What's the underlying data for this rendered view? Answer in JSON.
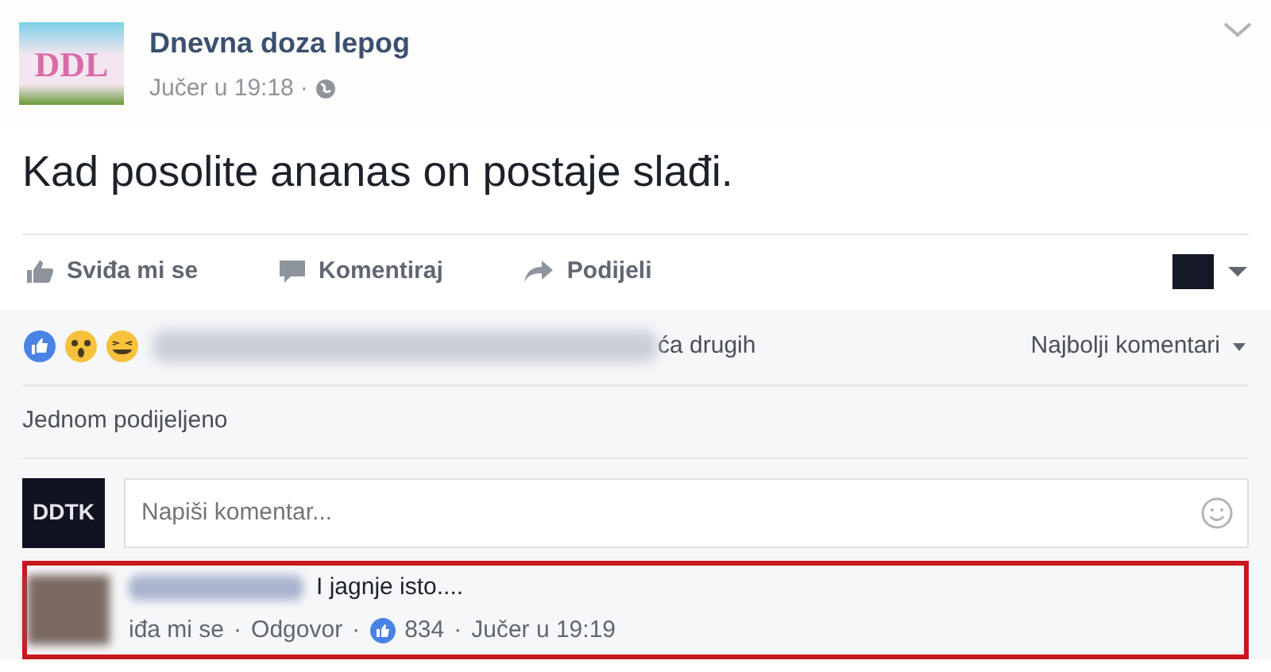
{
  "post": {
    "page_name": "Dnevna doza lepog",
    "logo_text": "DDL",
    "time": "Jučer u 19:18",
    "separator": "·",
    "text": "Kad posolite ananas on postaje slađi."
  },
  "actions": [
    {
      "kind": "like",
      "label": "Sviđa mi se"
    },
    {
      "kind": "comment",
      "label": "Komentiraj"
    },
    {
      "kind": "share",
      "label": "Podijeli"
    }
  ],
  "reactions": {
    "summary_visible": "ća drugih",
    "sort": "Najbolji komentari"
  },
  "shares": "Jednom podijeljeno",
  "comment_box": {
    "avatar_text": "DDTK",
    "placeholder": "Napiši komentar..."
  },
  "comment": {
    "text": "I jagnje isto....",
    "like_partial": "iđa mi se",
    "separator": "·",
    "reply": "Odgovor",
    "likes": "834",
    "time": "Jučer u 19:19",
    "highlighted": true
  }
}
